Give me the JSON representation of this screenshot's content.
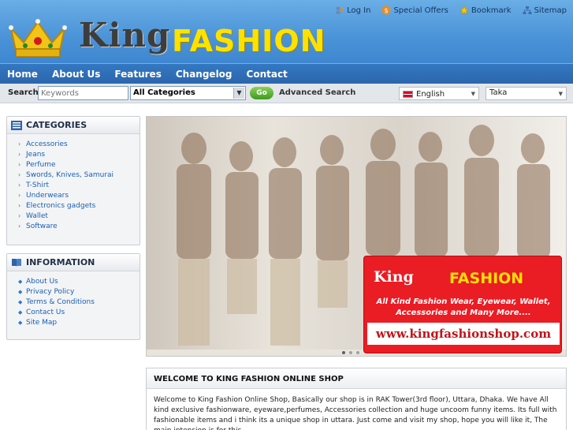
{
  "header": {
    "brand_king": "King",
    "brand_fashion": "FASHION",
    "links": [
      {
        "label": "Log In",
        "icon": "login-icon"
      },
      {
        "label": "Special Offers",
        "icon": "dollar-icon"
      },
      {
        "label": "Bookmark",
        "icon": "star-icon"
      },
      {
        "label": "Sitemap",
        "icon": "sitemap-icon"
      }
    ]
  },
  "nav": [
    "Home",
    "About Us",
    "Features",
    "Changelog",
    "Contact"
  ],
  "search": {
    "label": "Search:",
    "placeholder": "Keywords",
    "category": "All Categories",
    "go": "Go",
    "advanced": "Advanced Search",
    "language": "English",
    "currency": "Taka"
  },
  "categories": {
    "title": "CATEGORIES",
    "items": [
      "Accessories",
      "Jeans",
      "Perfume",
      "Swords, Knives, Samurai",
      "T-Shirt",
      "Underwears",
      "Electronics gadgets",
      "Wallet",
      "Software"
    ]
  },
  "information": {
    "title": "INFORMATION",
    "items": [
      "About Us",
      "Privacy Policy",
      "Terms & Conditions",
      "Contact Us",
      "Site Map"
    ]
  },
  "promo": {
    "brand_king": "King",
    "brand_fashion": "FASHION",
    "line1": "All Kind Fashion Wear, Eyewear, Wallet,",
    "line2": "Accessories and Many More....",
    "url": "www.kingfashionshop.com"
  },
  "welcome": {
    "title": "WELCOME TO KING FASHION ONLINE SHOP",
    "text": "Welcome to King Fashion Online Shop, Basically our shop is in RAK Tower(3rd floor), Uttara, Dhaka. We have All kind exclusive fashionware, eyeware,perfumes, Accessories collection and huge uncoom funny items. Its full with fashionable items and i think its a unique shop in uttara. Just come and visit my shop, hope you will like it, The main intension is for this"
  },
  "colors": {
    "accent": "#2b66ac",
    "brand_yellow": "#ffe100",
    "promo_red": "#ea1c24",
    "link": "#1a5fb0"
  }
}
